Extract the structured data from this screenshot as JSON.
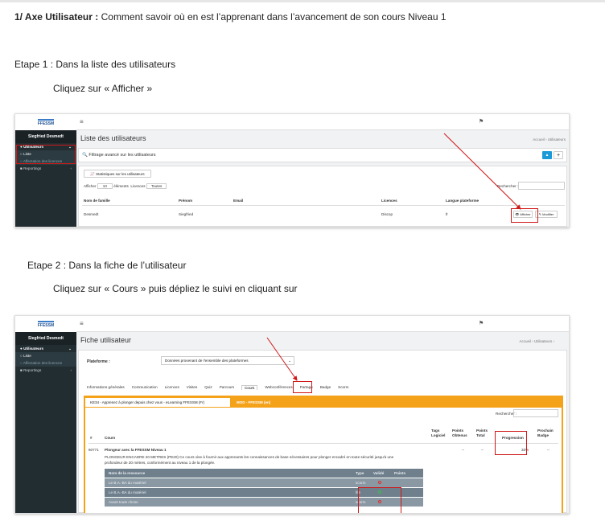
{
  "intro": {
    "title_bold": "1/ Axe Utilisateur :",
    "title_rest": " Comment savoir où en est l’apprenant dans l’avancement de son cours Niveau 1"
  },
  "step1": {
    "title": "Etape 1 : Dans la liste des utilisateurs",
    "instruction": "Cliquez sur « Afficher »"
  },
  "step2": {
    "title": "Etape 2 : Dans la fiche de l’utilisateur",
    "instruction": "Cliquez sur « Cours » puis dépliez le suivi en cliquant sur"
  },
  "app": {
    "logo": "FFESSM",
    "user_name": "Siegfried Desmedt",
    "menu_users": "Utilisateurs",
    "menu_list": "Liste",
    "menu_licenses": "Affectation des licences",
    "menu_reportings": "Reportings",
    "menu_icon": "≡",
    "flag_icon": "⚑"
  },
  "shot1": {
    "page_title": "Liste des utilisateurs",
    "breadcrumb": "Accueil  ›  Utilisateurs",
    "filter_label": "Filtrage avancé sur les utilisateurs",
    "stats_button": "Statistiques sur les utilisateurs",
    "show_label": "Afficher",
    "show_value": "10",
    "elements_label": "éléments",
    "licences_label": "Licences",
    "licences_value": "Toutes",
    "search_label": "Rechercher :",
    "columns": [
      "Nom de famille",
      "Prénom",
      "Email",
      "Licences",
      "Langue plateforme"
    ],
    "row": [
      "Desmedt",
      "Siegfried",
      "",
      "Discop",
      "fr"
    ],
    "btn_show": "Afficher",
    "btn_edit": "Modifier"
  },
  "shot2": {
    "page_title": "Fiche utilisateur",
    "breadcrumb": "Accueil  ›  Utilisateurs  ›",
    "platform_label": "Plateforme :",
    "platform_value": "Données provenant de l'ensemble des plateformes",
    "tabs": [
      "Informations générales",
      "Communication",
      "Licences",
      "Visites",
      "Quiz",
      "Parcours",
      "Cours",
      "Webconférences",
      "Partage",
      "Badge",
      "Scorm"
    ],
    "subtab_active": "KE34 - Apprenez à plonger depuis chez vous - eLearning FFESSM (Fr)",
    "subtab_other": "MOD - FFESSM (en)",
    "search_label": "Rechercher :",
    "col_num": "#",
    "col_course": "Cours",
    "col_tags": "Tags Logiciel",
    "col_points_obtained": "Points Obtenus",
    "col_points_total": "Points Total",
    "col_progress": "Progression",
    "col_badge": "Prochain Badge",
    "course_id": "60771",
    "course_title": "Plongeur avec la FFESSM Niveau 1",
    "course_desc_1": "PLONGEUR ENCADRE 20 METRES (PE20) Ce cours vise à fournir aux apprenants les connaissances de base nécessaires pour plonger encadré en toute sécurité jusqu'à une",
    "course_desc_2": "profondeur de 20 mètres, conformément au niveau 1 de la plongée.",
    "points_obtained": "--",
    "points_total": "--",
    "progress": "33%",
    "badge": "--",
    "res_col_name": "Nom de la ressource",
    "res_col_type": "Type",
    "res_col_valid": "Validé",
    "res_col_points": "Points",
    "resources": [
      {
        "name": "Le B.A.-BA du matériel",
        "type": "scorm"
      },
      {
        "name": "Le B.A.-BA du matériel",
        "type": "file"
      },
      {
        "name": "Avant toute chose",
        "type": "scorm"
      }
    ]
  }
}
